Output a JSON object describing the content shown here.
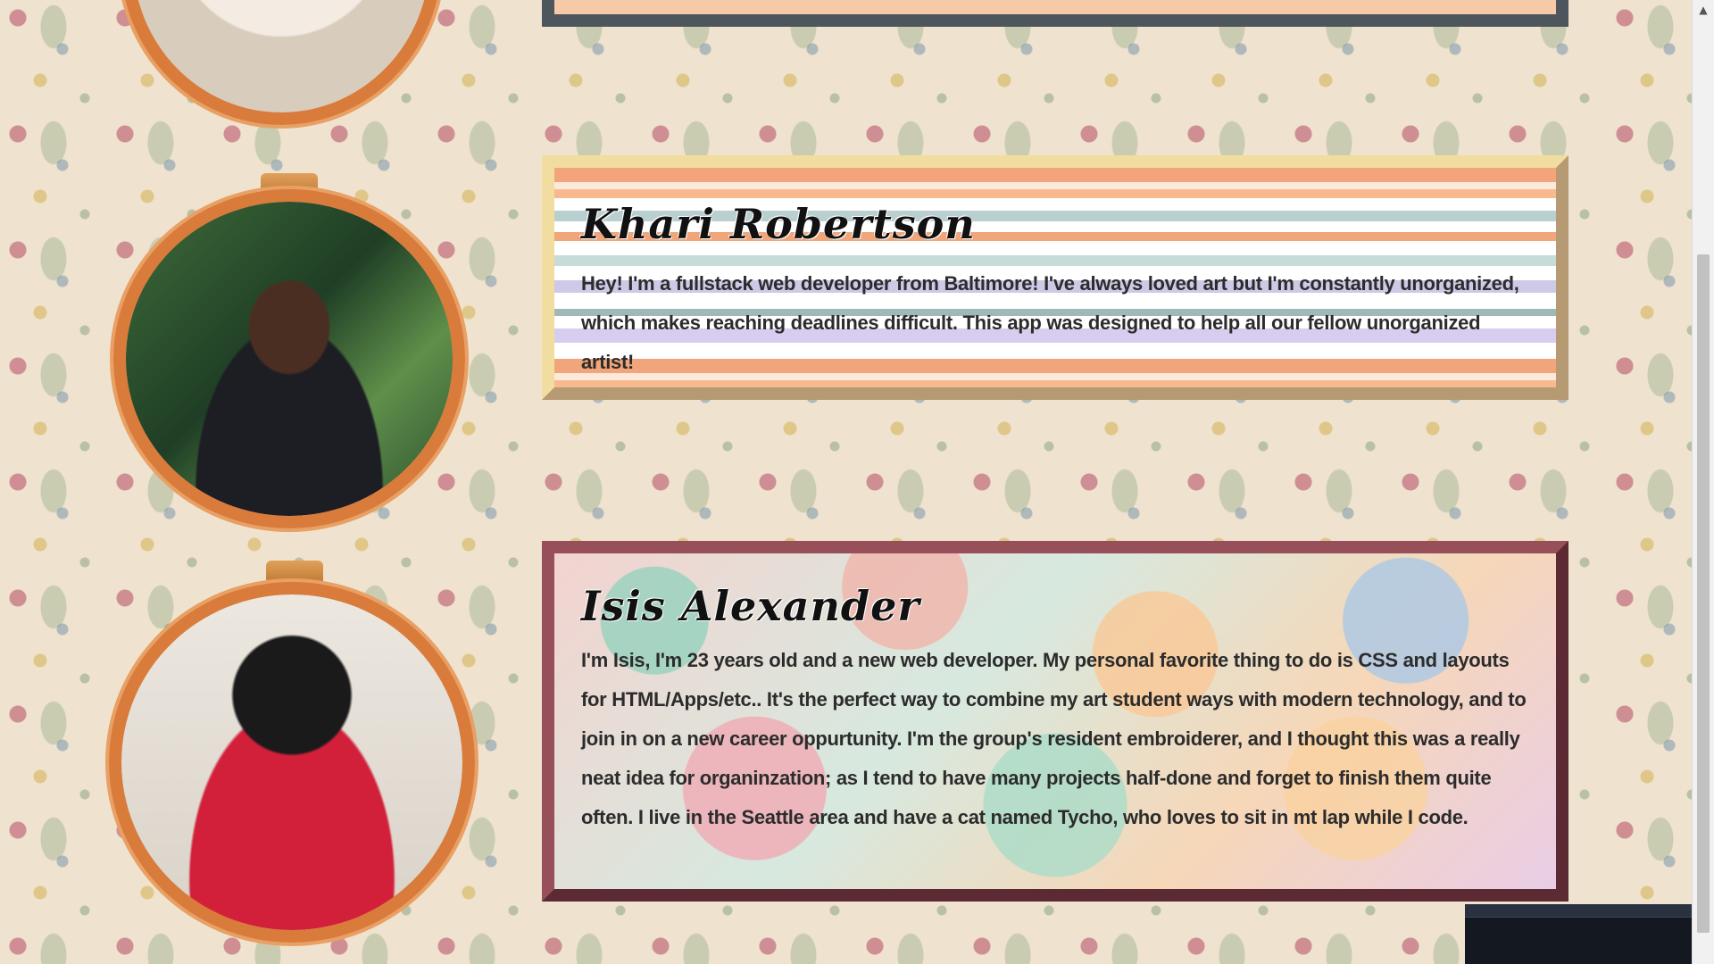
{
  "members": [
    {
      "name": "Khari Robertson",
      "bio": "Hey! I'm a fullstack web developer from Baltimore! I've always loved art but I'm constantly unorganized, which makes reaching deadlines difficult. This app was designed to help all our fellow unorganized artist!"
    },
    {
      "name": "Isis Alexander",
      "bio": "I'm Isis, I'm 23 years old and a new web developer. My personal favorite thing to do is CSS and layouts for HTML/Apps/etc.. It's the perfect way to combine my art student ways with modern technology, and to join in on a new career oppurtunity. I'm the group's resident embroiderer, and I thought this was a really neat idea for organinzation; as I tend to have many projects half-done and forget to finish them quite often. I live in the Seattle area and have a cat named Tycho, who loves to sit in mt lap while I code."
    }
  ],
  "icons": {
    "scroll_up": "▲"
  }
}
